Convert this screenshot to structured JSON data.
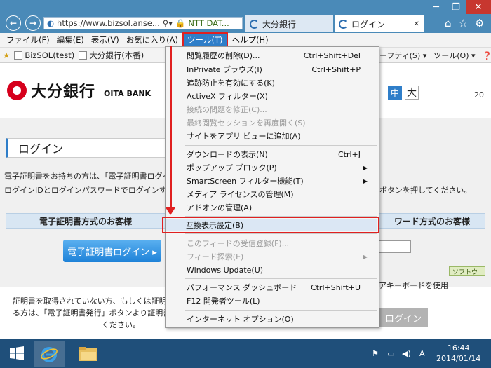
{
  "browser": {
    "address": "https://www.bizsol.anse...",
    "cert_label": "NTT DAT...",
    "tabs": [
      {
        "label": "大分銀行"
      },
      {
        "label": "ログイン"
      }
    ],
    "nav": {
      "back": "←",
      "forward": "→"
    },
    "window_controls": {
      "min": "─",
      "max": "❐",
      "close": "✕"
    },
    "right_icons": {
      "home": "⌂",
      "fav": "☆",
      "settings": "⚙"
    }
  },
  "menubar": {
    "items": [
      {
        "label": "ファイル(F)"
      },
      {
        "label": "編集(E)"
      },
      {
        "label": "表示(V)"
      },
      {
        "label": "お気に入り(A)"
      },
      {
        "label": "ツール(T)"
      },
      {
        "label": "ヘルプ(H)"
      }
    ]
  },
  "favbar": {
    "items": [
      {
        "label": "BizSOL(test)"
      },
      {
        "label": "大分銀行(本番)"
      }
    ],
    "right": [
      "セーフティ(S) ▾",
      "ツール(O) ▾",
      "❓▾"
    ]
  },
  "tools_menu": [
    {
      "label": "閲覧履歴の削除(D)...",
      "shortcut": "Ctrl+Shift+Del"
    },
    {
      "label": "InPrivate ブラウズ(I)",
      "shortcut": "Ctrl+Shift+P"
    },
    {
      "label": "追跡防止を有効にする(K)"
    },
    {
      "label": "ActiveX フィルター(X)"
    },
    {
      "label": "接続の問題を修正(C)...",
      "disabled": true
    },
    {
      "label": "最終閲覧セッションを再度開く(S)",
      "disabled": true
    },
    {
      "label": "サイトをアプリ ビューに追加(A)"
    },
    {
      "label": "ダウンロードの表示(N)",
      "shortcut": "Ctrl+J"
    },
    {
      "label": "ポップアップ ブロック(P)",
      "submenu": true
    },
    {
      "label": "SmartScreen フィルター機能(T)",
      "submenu": true
    },
    {
      "label": "メディア ライセンスの管理(M)"
    },
    {
      "label": "アドオンの管理(A)"
    },
    {
      "label": "互換表示設定(B)",
      "highlighted": true
    },
    {
      "label": "このフィードの受信登録(F)...",
      "disabled": true
    },
    {
      "label": "フィード探索(E)",
      "disabled": true,
      "submenu": true
    },
    {
      "label": "Windows Update(U)"
    },
    {
      "label": "パフォーマンス ダッシュボード",
      "shortcut": "Ctrl+Shift+U"
    },
    {
      "label": "F12 開発者ツール(L)"
    },
    {
      "label": "インターネット オプション(O)"
    }
  ],
  "page": {
    "logo_jp": "大分銀行",
    "logo_en": "OITA BANK",
    "size_buttons": [
      "中",
      "大"
    ],
    "corner_text": "20",
    "login_title": "ログイン",
    "desc_line1": "電子証明書をお持ちの方は、「電子証明書ログイ",
    "desc_line2": "ログインIDとログインパスワードでログインする場",
    "desc_right": "ボタンを押してください。",
    "panel_left": "電子証明書方式のお客様",
    "panel_right": "ワード方式のお客様",
    "cert_login_button": "電子証明書ログイン ▸",
    "soft_badge": "ソフトウ",
    "software_keyboard": "アキーボードを使用",
    "login_button": "ログイン",
    "cert_note1": "証明書を取得されていない方、もしくは証明書",
    "cert_note2": "る方は、「電子証明書発行」ボタンより証明書",
    "cert_note3": "ください。"
  },
  "taskbar": {
    "time": "16:44",
    "date": "2014/01/14",
    "ime": "A"
  },
  "colors": {
    "accent": "#2f7ec9",
    "annotation": "#e02020",
    "titlebar": "#4a8ab8",
    "taskbar": "#1f4f7a"
  }
}
